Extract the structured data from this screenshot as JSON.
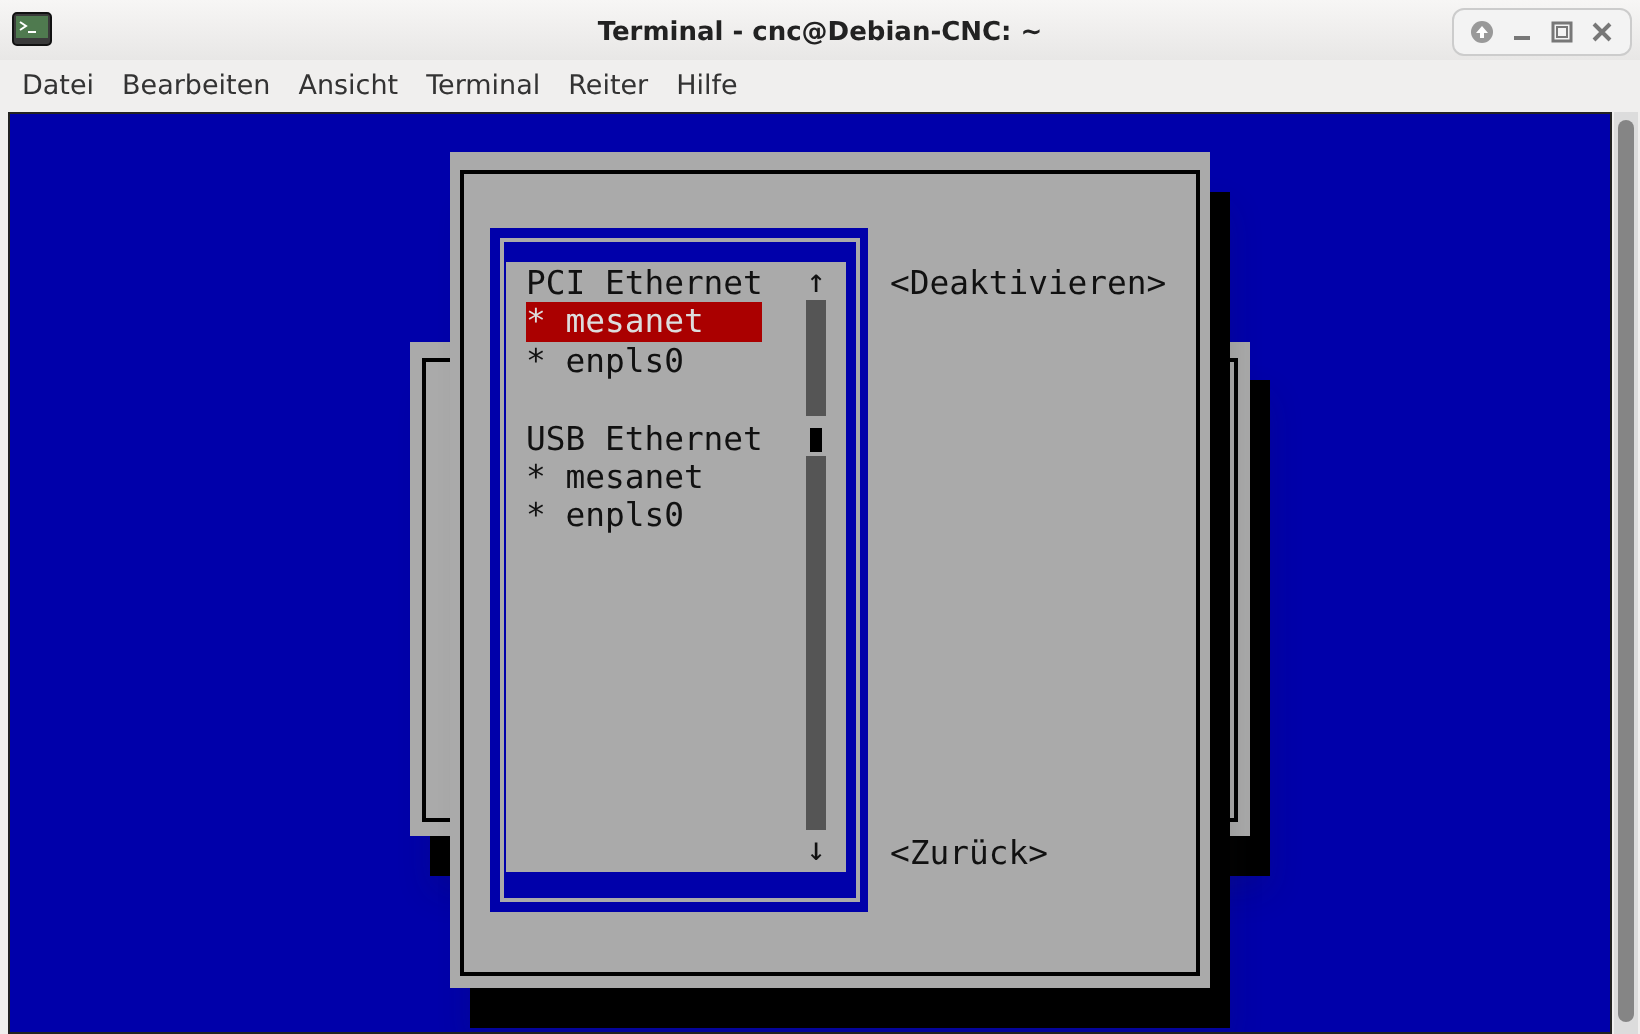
{
  "window": {
    "title": "Terminal - cnc@Debian-CNC: ~"
  },
  "menu": [
    "Datei",
    "Bearbeiten",
    "Ansicht",
    "Terminal",
    "Reiter",
    "Hilfe"
  ],
  "list": {
    "sections": [
      {
        "heading": "PCI Ethernet",
        "items": [
          {
            "label": "* mesanet",
            "selected": true
          },
          {
            "label": "* enpls0",
            "selected": false
          }
        ]
      },
      {
        "heading": "USB Ethernet",
        "items": [
          {
            "label": "* mesanet",
            "selected": false
          },
          {
            "label": "* enpls0",
            "selected": false
          }
        ]
      }
    ],
    "scroll_up": "↑",
    "scroll_down": "↓"
  },
  "buttons": [
    "<Deaktivieren>",
    "<Zurück>"
  ]
}
